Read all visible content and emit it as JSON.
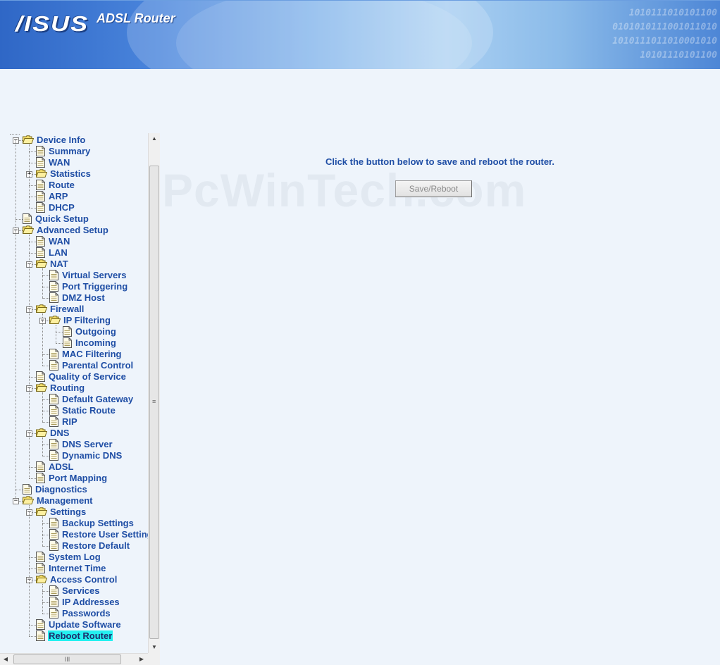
{
  "header": {
    "logo": "/ISUS",
    "product": "ADSL Router",
    "binary_lines": [
      "1010111010101100",
      "0101010111001011010",
      "1010111011010001010",
      "10101110101100"
    ]
  },
  "main": {
    "message": "Click the button below to save and reboot the router.",
    "save_button": "Save/Reboot",
    "watermark": "PcWinTech.com"
  },
  "nav": {
    "selected": "Reboot Router",
    "items": [
      {
        "label": "Device Info",
        "level": 0,
        "type": "folder",
        "expander": "minus"
      },
      {
        "label": "Summary",
        "level": 1,
        "type": "page"
      },
      {
        "label": "WAN",
        "level": 1,
        "type": "page"
      },
      {
        "label": "Statistics",
        "level": 1,
        "type": "folder",
        "expander": "plus"
      },
      {
        "label": "Route",
        "level": 1,
        "type": "page"
      },
      {
        "label": "ARP",
        "level": 1,
        "type": "page"
      },
      {
        "label": "DHCP",
        "level": 1,
        "type": "page"
      },
      {
        "label": "Quick Setup",
        "level": 0,
        "type": "page"
      },
      {
        "label": "Advanced Setup",
        "level": 0,
        "type": "folder",
        "expander": "minus"
      },
      {
        "label": "WAN",
        "level": 1,
        "type": "page"
      },
      {
        "label": "LAN",
        "level": 1,
        "type": "page"
      },
      {
        "label": "NAT",
        "level": 1,
        "type": "folder",
        "expander": "minus"
      },
      {
        "label": "Virtual Servers",
        "level": 2,
        "type": "page"
      },
      {
        "label": "Port Triggering",
        "level": 2,
        "type": "page"
      },
      {
        "label": "DMZ Host",
        "level": 2,
        "type": "page"
      },
      {
        "label": "Firewall",
        "level": 1,
        "type": "folder",
        "expander": "minus"
      },
      {
        "label": "IP Filtering",
        "level": 2,
        "type": "folder",
        "expander": "minus"
      },
      {
        "label": "Outgoing",
        "level": 3,
        "type": "page"
      },
      {
        "label": "Incoming",
        "level": 3,
        "type": "page"
      },
      {
        "label": "MAC Filtering",
        "level": 2,
        "type": "page"
      },
      {
        "label": "Parental Control",
        "level": 2,
        "type": "page"
      },
      {
        "label": "Quality of Service",
        "level": 1,
        "type": "page"
      },
      {
        "label": "Routing",
        "level": 1,
        "type": "folder",
        "expander": "minus"
      },
      {
        "label": "Default Gateway",
        "level": 2,
        "type": "page"
      },
      {
        "label": "Static Route",
        "level": 2,
        "type": "page"
      },
      {
        "label": "RIP",
        "level": 2,
        "type": "page"
      },
      {
        "label": "DNS",
        "level": 1,
        "type": "folder",
        "expander": "minus"
      },
      {
        "label": "DNS Server",
        "level": 2,
        "type": "page"
      },
      {
        "label": "Dynamic DNS",
        "level": 2,
        "type": "page"
      },
      {
        "label": "ADSL",
        "level": 1,
        "type": "page"
      },
      {
        "label": "Port Mapping",
        "level": 1,
        "type": "page"
      },
      {
        "label": "Diagnostics",
        "level": 0,
        "type": "page"
      },
      {
        "label": "Management",
        "level": 0,
        "type": "folder",
        "expander": "minus"
      },
      {
        "label": "Settings",
        "level": 1,
        "type": "folder",
        "expander": "minus"
      },
      {
        "label": "Backup Settings",
        "level": 2,
        "type": "page"
      },
      {
        "label": "Restore User Settings",
        "level": 2,
        "type": "page"
      },
      {
        "label": "Restore Default",
        "level": 2,
        "type": "page"
      },
      {
        "label": "System Log",
        "level": 1,
        "type": "page"
      },
      {
        "label": "Internet Time",
        "level": 1,
        "type": "page"
      },
      {
        "label": "Access Control",
        "level": 1,
        "type": "folder",
        "expander": "minus"
      },
      {
        "label": "Services",
        "level": 2,
        "type": "page"
      },
      {
        "label": "IP Addresses",
        "level": 2,
        "type": "page"
      },
      {
        "label": "Passwords",
        "level": 2,
        "type": "page"
      },
      {
        "label": "Update Software",
        "level": 1,
        "type": "page"
      },
      {
        "label": "Reboot Router",
        "level": 1,
        "type": "page"
      }
    ]
  },
  "scrollbar_glyphs": {
    "up": "▲",
    "down": "▼",
    "left": "◀",
    "right": "▶",
    "grip_v": "≡",
    "grip_h": "III"
  },
  "colors": {
    "link": "#1f4ea5",
    "selected_bg": "#24f0f0",
    "background": "#eef4fb"
  }
}
